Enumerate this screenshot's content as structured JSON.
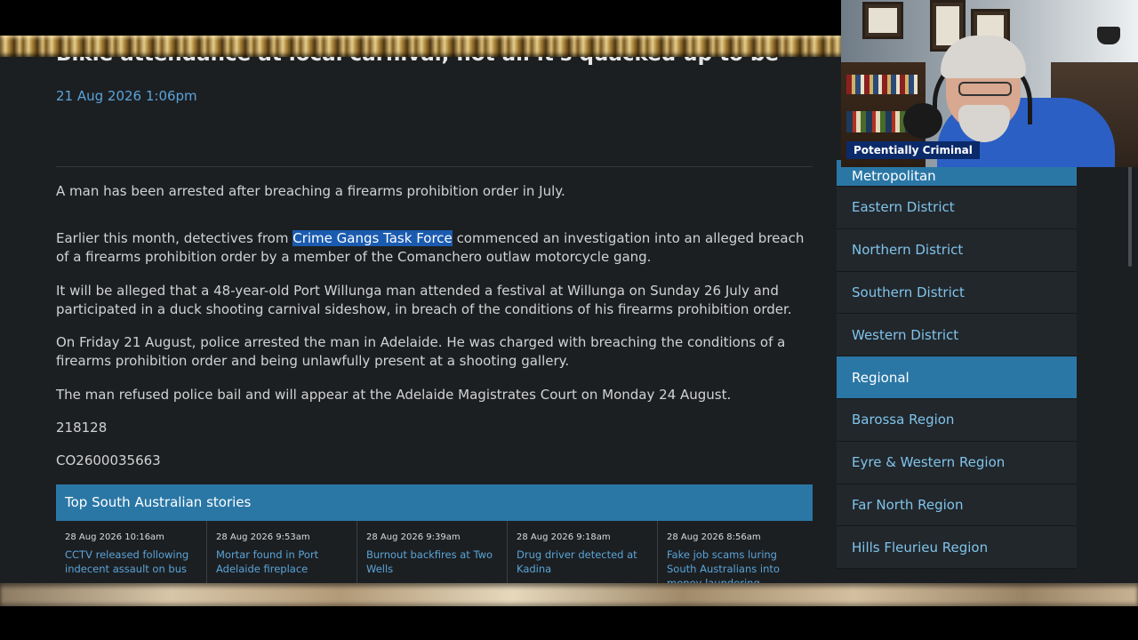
{
  "article": {
    "headline": "Bikie attendance at local carnival, not all it's quacked up to be",
    "date": "21 Aug 2026 1:06pm",
    "intro": "A man has been arrested after breaching a firearms prohibition order in July.",
    "para1_before": "Earlier this month, detectives from ",
    "para1_highlight": "Crime Gangs Task Force",
    "para1_after": " commenced an investigation into an alleged breach of a firearms prohibition order by a member of the Comanchero outlaw motorcycle gang.",
    "para2": "It will be alleged that a 48-year-old Port Willunga man attended a festival at Willunga on Sunday 26 July and participated in a duck shooting carnival sideshow, in breach of the conditions of his firearms prohibition order.",
    "para3": "On Friday 21 August, police arrested the man in Adelaide. He was charged with breaching the conditions of a firearms prohibition order and being unlawfully present at a shooting gallery.",
    "para4": "The man refused police bail and will appear at the Adelaide Magistrates Court on Monday 24 August.",
    "ref1": "218128",
    "ref2": "CO2600035663"
  },
  "top_stories": {
    "title": "Top South Australian stories",
    "items": [
      {
        "date": "28 Aug 2026 10:16am",
        "title": "CCTV released following indecent assault on bus"
      },
      {
        "date": "28 Aug 2026 9:53am",
        "title": "Mortar found in Port Adelaide fireplace"
      },
      {
        "date": "28 Aug 2026 9:39am",
        "title": "Burnout backfires at Two Wells"
      },
      {
        "date": "28 Aug 2026 9:18am",
        "title": "Drug driver detected at Kadina"
      },
      {
        "date": "28 Aug 2026 8:56am",
        "title": "Fake job scams luring South Australians into money laundering"
      }
    ]
  },
  "sidebar": {
    "items": [
      {
        "label": "Metropolitan"
      },
      {
        "label": "Eastern District"
      },
      {
        "label": "Northern District"
      },
      {
        "label": "Southern District"
      },
      {
        "label": "Western District"
      },
      {
        "label": "Regional"
      },
      {
        "label": "Barossa Region"
      },
      {
        "label": "Eyre & Western Region"
      },
      {
        "label": "Far North Region"
      },
      {
        "label": "Hills Fleurieu Region"
      }
    ]
  },
  "webcam": {
    "label": "Potentially Criminal"
  },
  "colors": {
    "page_bg": "#1c1f22",
    "accent": "#2a77a6",
    "link": "#5aa4d8",
    "highlight": "#1a5bb0"
  }
}
